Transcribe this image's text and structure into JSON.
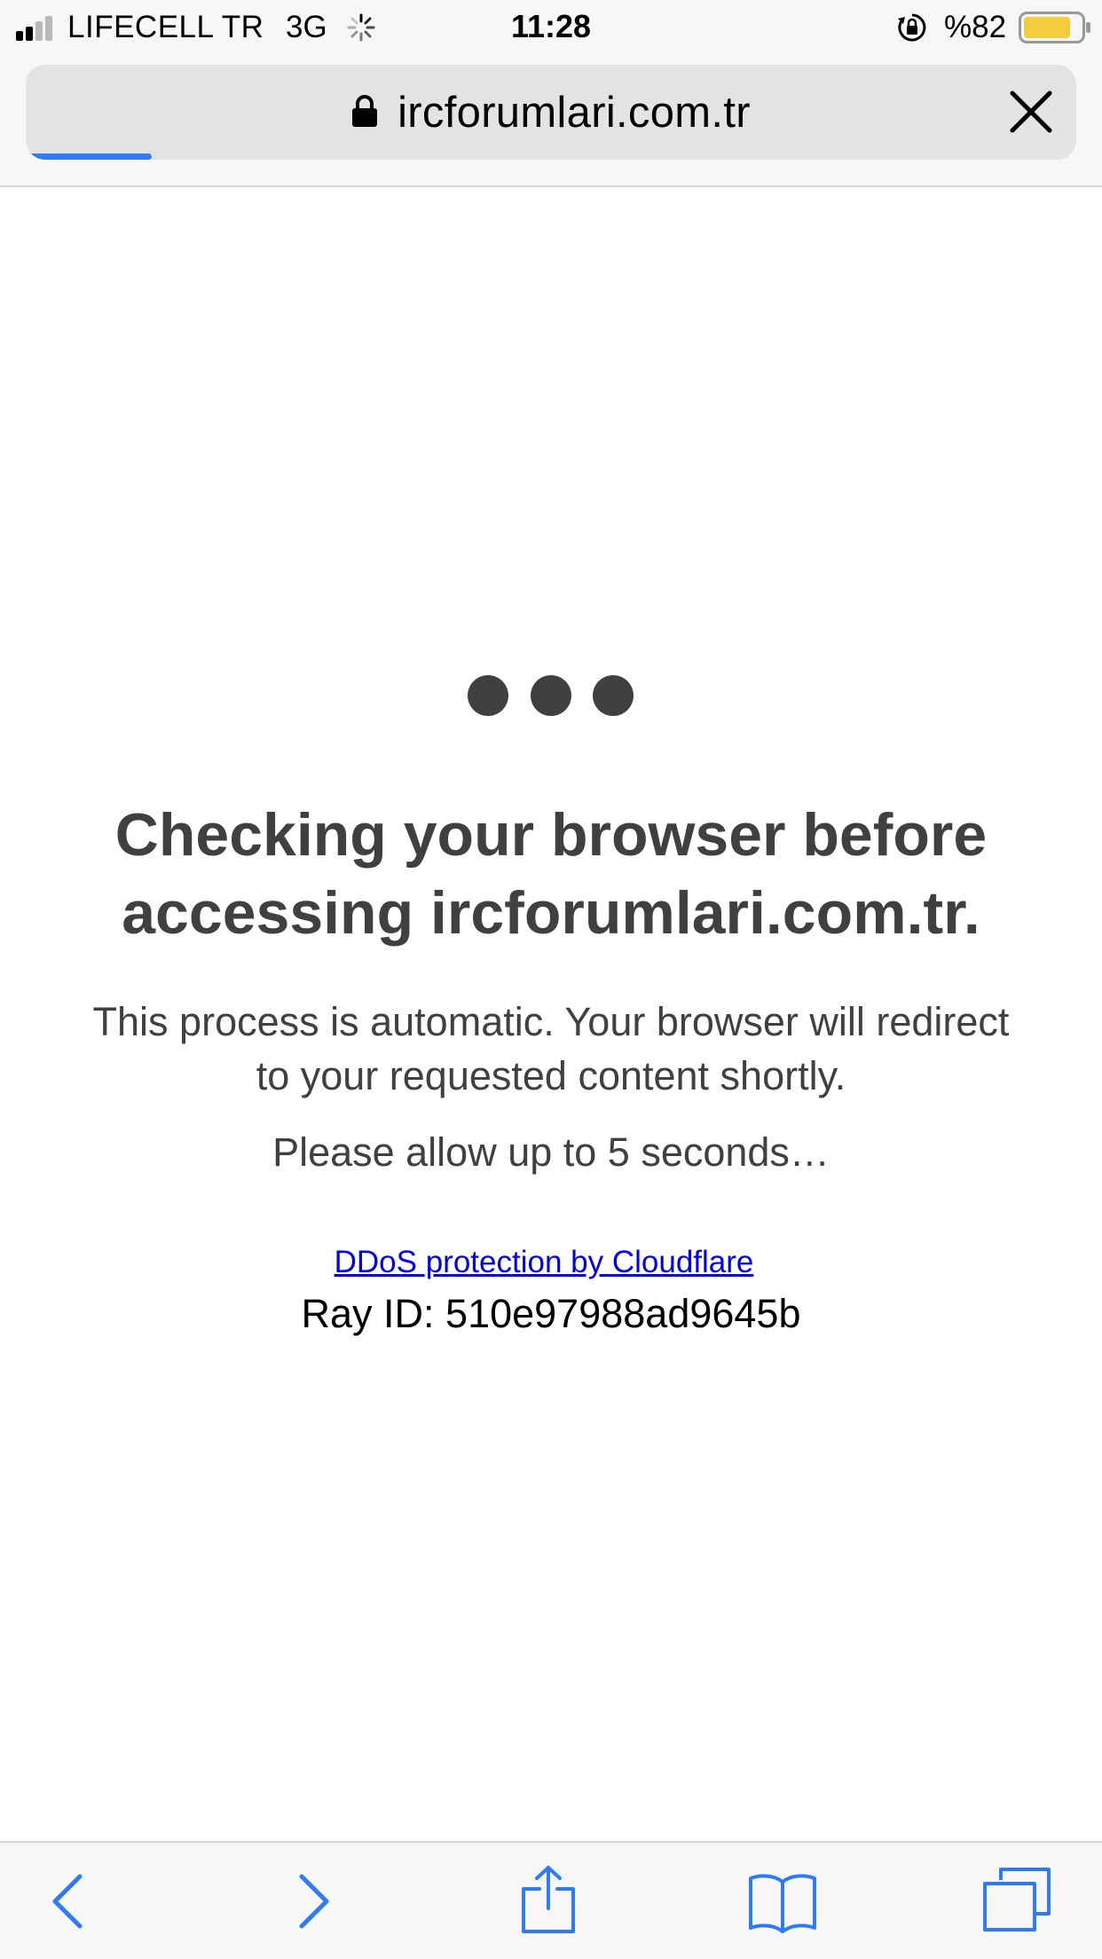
{
  "status_bar": {
    "carrier": "LIFECELL TR",
    "network": "3G",
    "time": "11:28",
    "battery_percent": "%82",
    "battery_level": 0.82,
    "battery_color": "#f5cc3c",
    "icons": [
      "signal-icon",
      "activity-spinner-icon",
      "rotation-lock-icon",
      "battery-icon"
    ]
  },
  "browser": {
    "url": "ircforumlari.com.tr",
    "load_progress": 0.12,
    "accent_color": "#2f7bf6",
    "icons": [
      "lock-icon",
      "close-icon"
    ]
  },
  "page": {
    "heading_line1": "Checking your browser before",
    "heading_line2": "accessing ircforumlari.com.tr.",
    "description_line1": "This process is automatic. Your browser will redirect",
    "description_line2": "to your requested content shortly.",
    "wait_text": "Please allow up to 5 seconds…",
    "ddos_link": "DDoS protection by Cloudflare",
    "ray_id": "Ray ID: 510e97988ad9645b",
    "text_color": "#404040",
    "link_color": "#0000ee"
  },
  "toolbar": {
    "icons": [
      "back-icon",
      "forward-icon",
      "share-icon",
      "bookmarks-icon",
      "tabs-icon"
    ],
    "icon_color": "#2f7bf6"
  }
}
